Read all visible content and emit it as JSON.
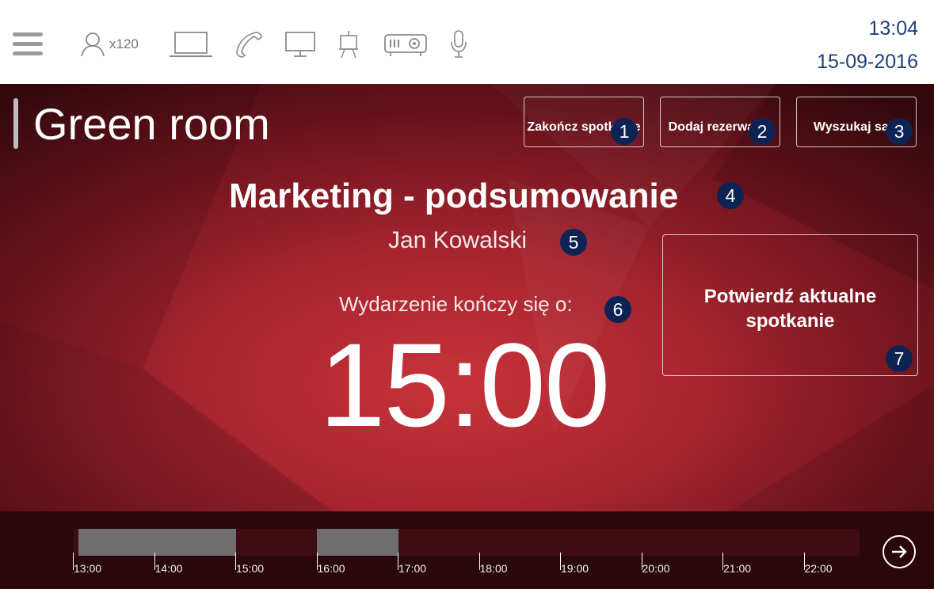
{
  "header": {
    "capacity": "x120",
    "amenities": [
      "person-icon",
      "laptop-icon",
      "phone-icon",
      "monitor-icon",
      "flipchart-icon",
      "projector-icon",
      "microphone-icon"
    ],
    "time": "13:04",
    "date": "15-09-2016"
  },
  "room": {
    "name": "Green room"
  },
  "actions": {
    "end_meeting": "Zakończ spotkanie",
    "add_booking": "Dodaj rezerwację",
    "find_room": "Wyszukaj salę"
  },
  "meeting": {
    "title": "Marketing - podsumowanie",
    "organizer": "Jan Kowalski",
    "end_label": "Wydarzenie kończy się o:",
    "end_time": "15:00",
    "confirm_label": "Potwierdź aktualne spotkanie"
  },
  "markers": [
    "1",
    "2",
    "3",
    "4",
    "5",
    "6",
    "7"
  ],
  "timeline": {
    "hours": [
      "13:00",
      "14:00",
      "15:00",
      "16:00",
      "17:00",
      "18:00",
      "19:00",
      "20:00",
      "21:00",
      "22:00"
    ],
    "bookings": [
      {
        "start": "13:04",
        "end": "15:00"
      },
      {
        "start": "16:00",
        "end": "17:00"
      }
    ]
  },
  "colors": {
    "accent": "#1f3f78",
    "marker": "#0d2354",
    "panel": "#c8323a",
    "booking": "#6e6e6e"
  }
}
